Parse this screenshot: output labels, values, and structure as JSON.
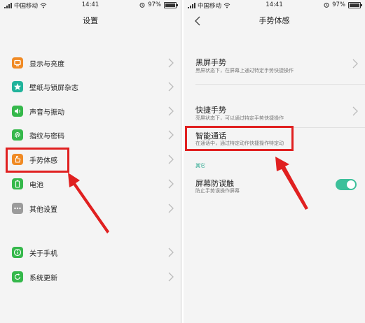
{
  "left": {
    "status": {
      "carrier": "中国移动",
      "time": "14:41",
      "battery": "97%",
      "battery_level": 0.97
    },
    "title": "设置",
    "items": [
      {
        "label": "显示与亮度",
        "icon": "display-icon",
        "color": "#f08a24"
      },
      {
        "label": "壁纸与锁屏杂志",
        "icon": "wallpaper-icon",
        "color": "#21b39b"
      },
      {
        "label": "声音与振动",
        "icon": "sound-icon",
        "color": "#35b84b"
      },
      {
        "label": "指纹与密码",
        "icon": "fingerprint-icon",
        "color": "#35b84b"
      },
      {
        "label": "手势体感",
        "icon": "gesture-icon",
        "color": "#f08a24"
      },
      {
        "label": "电池",
        "icon": "battery-icon",
        "color": "#35b84b"
      },
      {
        "label": "其他设置",
        "icon": "more-icon",
        "color": "#9b9b9b"
      },
      {
        "label": "关于手机",
        "icon": "info-icon",
        "color": "#35b84b"
      },
      {
        "label": "系统更新",
        "icon": "update-icon",
        "color": "#35b84b"
      }
    ]
  },
  "right": {
    "status": {
      "carrier": "中国移动",
      "time": "14:41",
      "battery": "97%",
      "battery_level": 0.97
    },
    "title": "手势体感",
    "items": [
      {
        "title": "黑屏手势",
        "desc": "黑屏状态下，在屏幕上通过特定手势快捷操作"
      },
      {
        "title": "快捷手势",
        "desc": "亮屏状态下，可以通过特定手势快捷操作"
      },
      {
        "title": "智能通话",
        "desc": "在通话中，通过特定动作快捷操作特定动"
      }
    ],
    "section_label": "其它",
    "toggle_item": {
      "title": "屏幕防误触",
      "desc": "防止手势误操作屏幕",
      "enabled": true
    }
  },
  "colors": {
    "accent": "#3cc09a",
    "highlight": "#e02020"
  }
}
